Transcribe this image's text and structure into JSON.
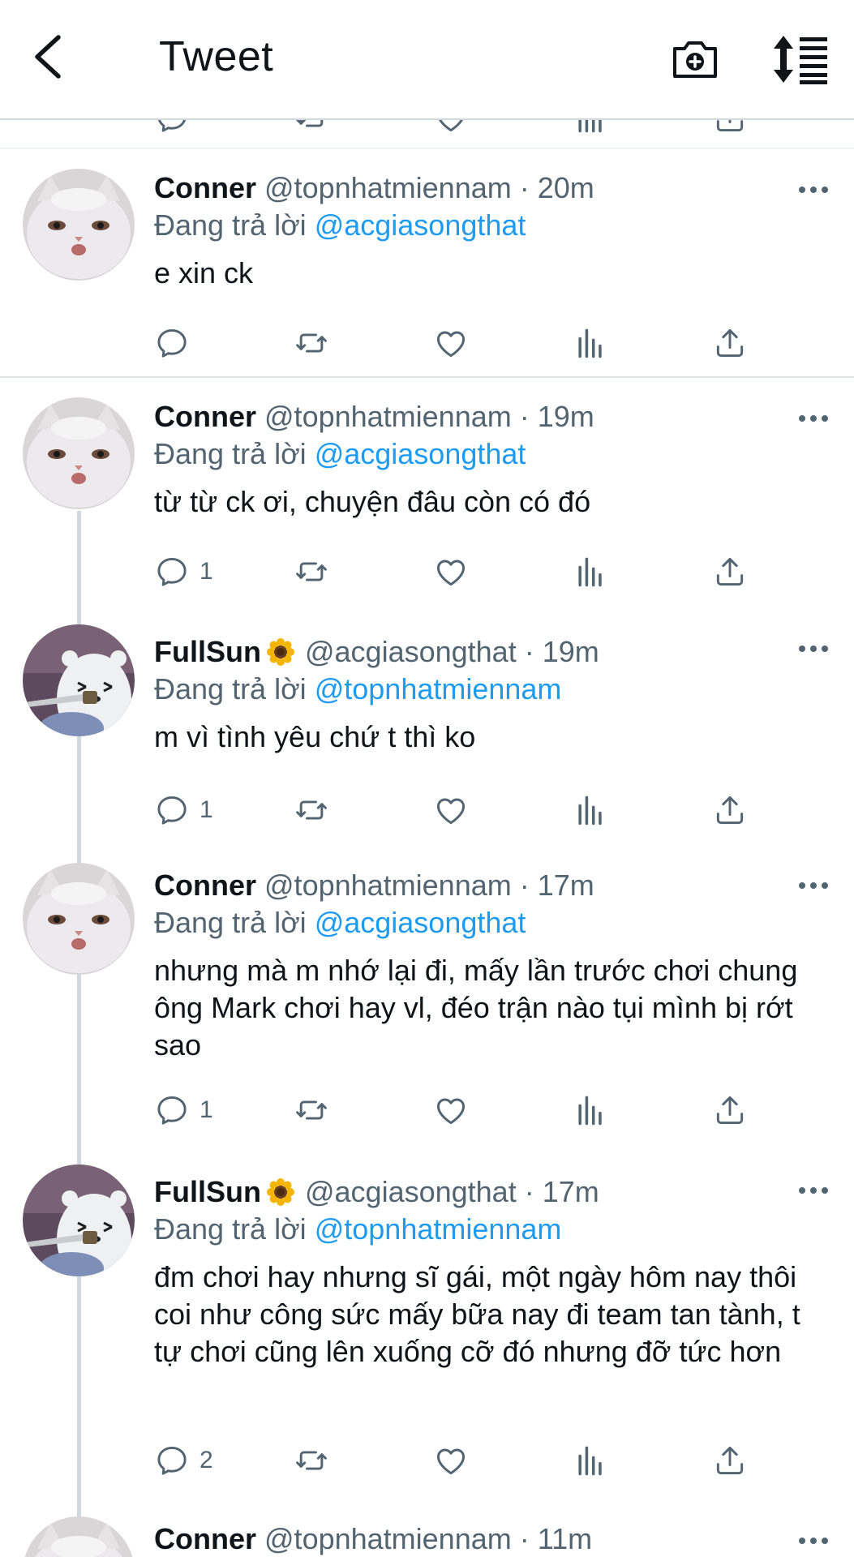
{
  "header": {
    "title": "Tweet",
    "back_icon": "chevron-left-icon",
    "camera_icon": "camera-plus-icon",
    "sort_icon": "sort-icon"
  },
  "colors": {
    "accent": "#1d9bf0",
    "muted": "#536471",
    "text": "#0f1419",
    "divider": "#cfd9de"
  },
  "tweets": [
    {
      "name": "Conner",
      "handle": "@topnhatmiennam",
      "time": "· 20m",
      "replying_prefix": "Đang trả lời",
      "replying_to": "@acgiasongthat",
      "text": "e xin ck",
      "reply_count": "",
      "avatar": "cat-avatar"
    },
    {
      "name": "Conner",
      "handle": "@topnhatmiennam",
      "time": "· 19m",
      "replying_prefix": "Đang trả lời",
      "replying_to": "@acgiasongthat",
      "text": "từ từ ck ơi, chuyện đâu còn có đó",
      "reply_count": "1",
      "avatar": "cat-avatar"
    },
    {
      "name": "FullSun",
      "handle": "@acgiasongthat",
      "time": "· 19m",
      "replying_prefix": "Đang trả lời",
      "replying_to": "@topnhatmiennam",
      "text": "m vì tình yêu chứ t thì ko",
      "reply_count": "1",
      "avatar": "bear-avatar",
      "emoji": "sunflower"
    },
    {
      "name": "Conner",
      "handle": "@topnhatmiennam",
      "time": "· 17m",
      "replying_prefix": "Đang trả lời",
      "replying_to": "@acgiasongthat",
      "text": "nhưng mà m nhớ lại đi, mấy lần trước chơi chung ông Mark chơi hay vl, đéo trận nào tụi mình bị rớt sao",
      "reply_count": "1",
      "avatar": "cat-avatar"
    },
    {
      "name": "FullSun",
      "handle": "@acgiasongthat",
      "time": "· 17m",
      "replying_prefix": "Đang trả lời",
      "replying_to": "@topnhatmiennam",
      "text": "đm chơi hay nhưng sĩ gái, một ngày hôm nay thôi coi như công sức mấy bữa nay đi team tan tành, t tự chơi cũng lên xuống cỡ đó nhưng đỡ tức hơn",
      "reply_count": "2",
      "avatar": "bear-avatar",
      "emoji": "sunflower"
    },
    {
      "name": "Conner",
      "handle": "@topnhatmiennam",
      "time": "· 11m",
      "avatar": "cat-avatar"
    }
  ]
}
